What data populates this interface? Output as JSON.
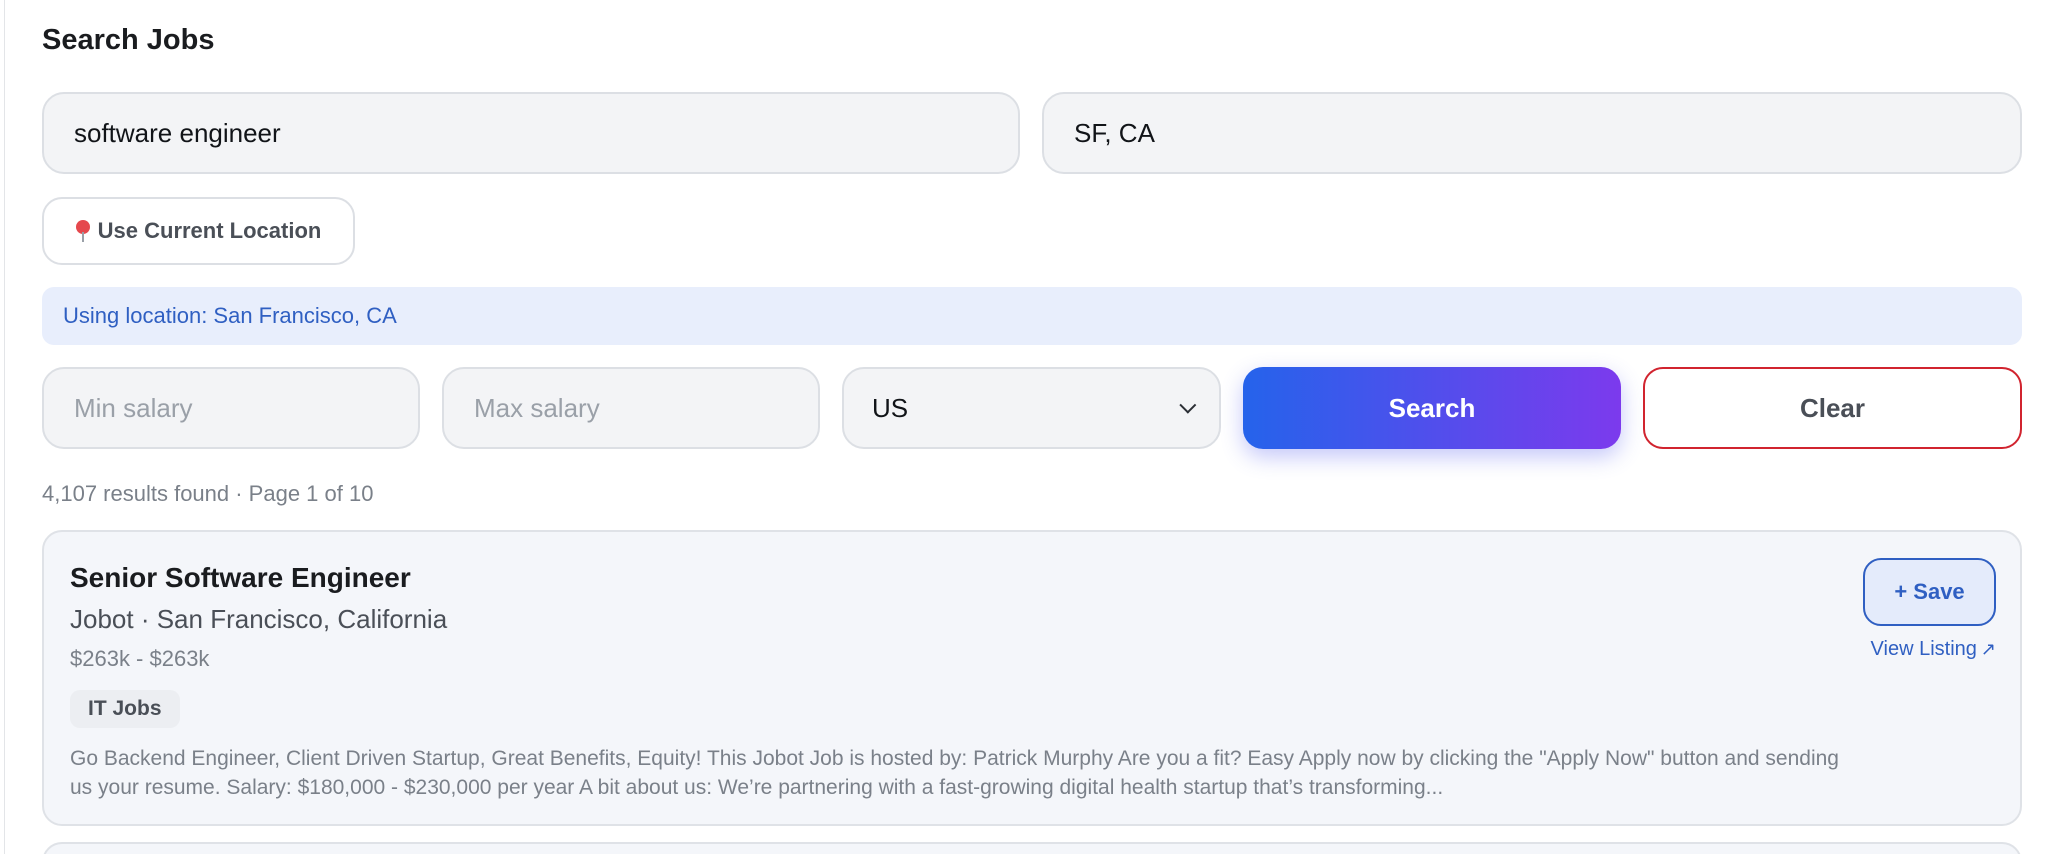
{
  "page": {
    "title": "Search Jobs"
  },
  "search": {
    "keyword": {
      "value": "software engineer",
      "placeholder": ""
    },
    "location": {
      "value": "SF, CA",
      "placeholder": ""
    },
    "use_location_label": "Use Current Location",
    "location_banner": "Using location: San Francisco, CA",
    "min_salary": {
      "value": "",
      "placeholder": "Min salary"
    },
    "max_salary": {
      "value": "",
      "placeholder": "Max salary"
    },
    "country": {
      "selected": "US"
    },
    "search_label": "Search",
    "clear_label": "Clear"
  },
  "results": {
    "summary": "4,107 results found · Page 1 of 10",
    "jobs": [
      {
        "title": "Senior Software Engineer",
        "company_location": "Jobot · San Francisco, California",
        "salary": "$263k - $263k",
        "tag": "IT Jobs",
        "description": "Go Backend Engineer, Client Driven Startup, Great Benefits, Equity! This Jobot Job is hosted by: Patrick Murphy Are you a fit? Easy Apply now by clicking the \"Apply Now\" button and sending us your resume. Salary: $180,000 - $230,000 per year A bit about us: We’re partnering with a fast-growing digital health startup that’s transforming...",
        "save_label": "+ Save",
        "view_label": "View Listing",
        "view_arrow": "↗"
      }
    ]
  },
  "colors": {
    "accent_blue": "#2563eb",
    "accent_purple": "#7c3aed",
    "link_blue": "#2f5fc2",
    "clear_border_red": "#d1242f",
    "banner_bg": "#e8eefc"
  },
  "icons": {
    "location_button": "map-pin-icon",
    "select": "chevron-down-icon",
    "view_link": "external-arrow-icon"
  }
}
